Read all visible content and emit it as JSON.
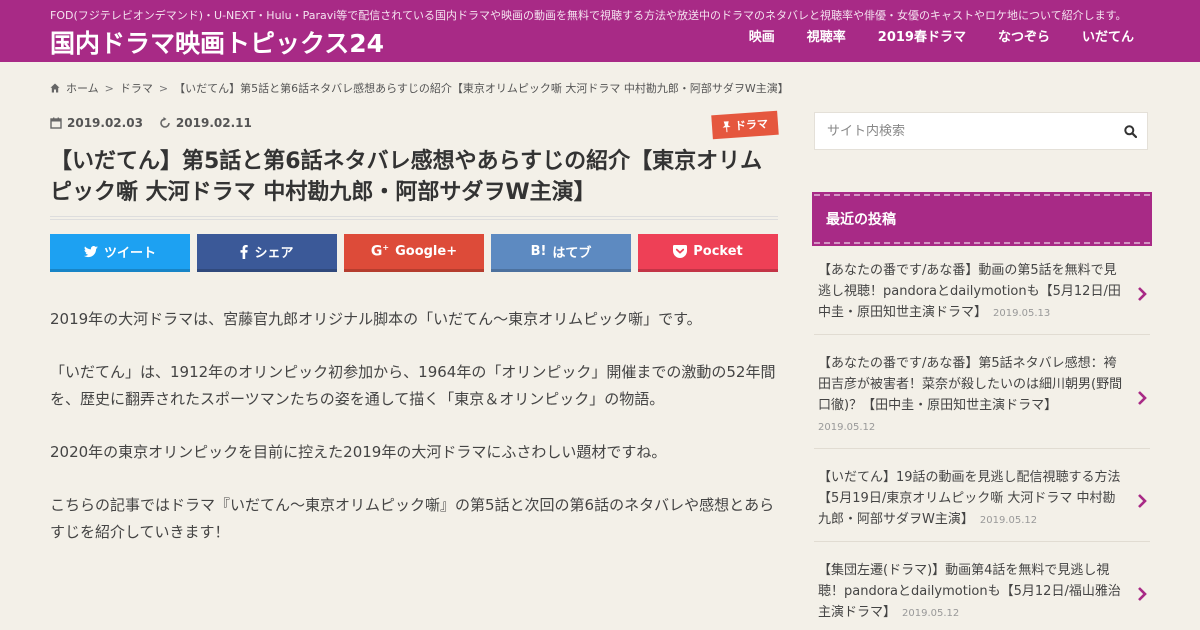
{
  "header": {
    "description": "FOD(フジテレビオンデマンド)・U-NEXT・Hulu・Paravi等で配信されている国内ドラマや映画の動画を無料で視聴する方法や放送中のドラマのネタバレと視聴率や俳優・女優のキャストやロケ地について紹介します。",
    "site_title": "国内ドラマ映画トピックス24",
    "nav": [
      "映画",
      "視聴率",
      "2019春ドラマ",
      "なつぞら",
      "いだてん"
    ]
  },
  "breadcrumb": {
    "home": "ホーム",
    "category": "ドラマ",
    "current": "【いだてん】第5話と第6話ネタバレ感想あらすじの紹介【東京オリムピック噺 大河ドラマ 中村勘九郎・阿部サダヲW主演】"
  },
  "article": {
    "published": "2019.02.03",
    "updated": "2019.02.11",
    "category_badge": "ドラマ",
    "title": "【いだてん】第5話と第6話ネタバレ感想やあらすじの紹介【東京オリムピック噺 大河ドラマ 中村勘九郎・阿部サダヲW主演】",
    "share": {
      "tweet": "ツイート",
      "facebook": "シェア",
      "google": "Google+",
      "hatena": "はてブ",
      "pocket": "Pocket"
    },
    "paragraphs": [
      "2019年の大河ドラマは、宮藤官九郎オリジナル脚本の「いだてん～東京オリムピック噺」です。",
      "「いだてん」は、1912年のオリンピック初参加から、1964年の「オリンピック」開催までの激動の52年間を、歴史に翻弄されたスポーツマンたちの姿を通して描く「東京＆オリンピック」の物語。",
      "2020年の東京オリンピックを目前に控えた2019年の大河ドラマにふさわしい題材ですね。",
      "こちらの記事ではドラマ『いだてん～東京オリムピック噺』の第5話と次回の第6話のネタバレや感想とあらすじを紹介していきます！"
    ]
  },
  "sidebar": {
    "search_placeholder": "サイト内検索",
    "recent_title": "最近の投稿",
    "recent_posts": [
      {
        "title": "【あなたの番です/あな番】動画の第5話を無料で見逃し視聴！pandoraとdailymotionも【5月12日/田中圭・原田知世主演ドラマ】",
        "date": "2019.05.13"
      },
      {
        "title": "【あなたの番です/あな番】第5話ネタバレ感想：袴田吉彦が被害者！菜奈が殺したいのは細川朝男(野間口徹)？【田中圭・原田知世主演ドラマ】",
        "date": "2019.05.12"
      },
      {
        "title": "【いだてん】19話の動画を見逃し配信視聴する方法【5月19日/東京オリムピック噺 大河ドラマ 中村勘九郎・阿部サダヲW主演】",
        "date": "2019.05.12"
      },
      {
        "title": "【集団左遷(ドラマ)】動画第4話を無料で見逃し視聴！pandoraとdailymotionも【5月12日/福山雅治主演ドラマ】",
        "date": "2019.05.12"
      }
    ]
  },
  "colors": {
    "brand": "#a82a86",
    "twitter": "#1da1f2",
    "facebook": "#3b5998",
    "google": "#dd4b39",
    "hatena": "#5d8ac1",
    "pocket": "#ee4056",
    "badge": "#e5573e"
  }
}
